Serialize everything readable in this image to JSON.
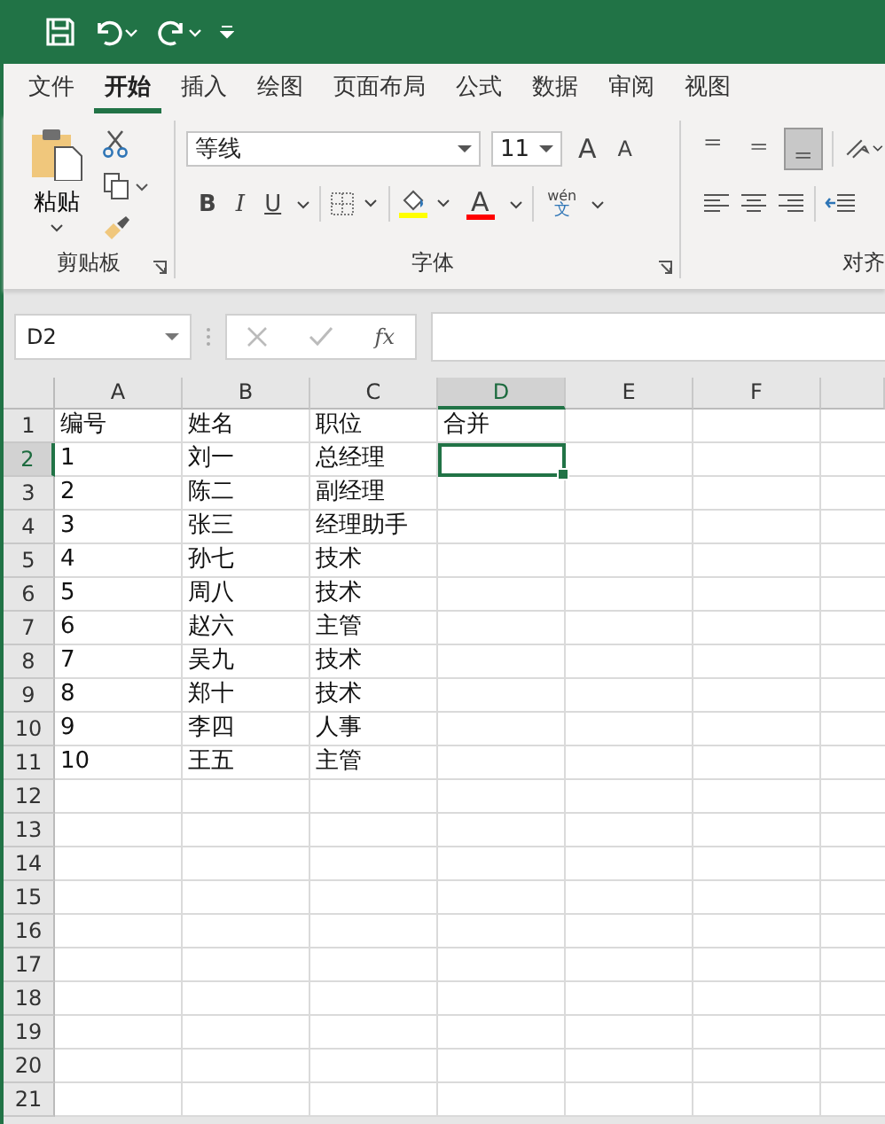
{
  "ribbon_tabs": [
    {
      "label": "文件",
      "selected": false
    },
    {
      "label": "开始",
      "selected": true
    },
    {
      "label": "插入",
      "selected": false
    },
    {
      "label": "绘图",
      "selected": false
    },
    {
      "label": "页面布局",
      "selected": false
    },
    {
      "label": "公式",
      "selected": false
    },
    {
      "label": "数据",
      "selected": false
    },
    {
      "label": "审阅",
      "selected": false
    },
    {
      "label": "视图",
      "selected": false
    }
  ],
  "clipboard_group": {
    "paste_label": "粘贴",
    "label": "剪贴板"
  },
  "font_group": {
    "font_name": "等线",
    "font_size": "11",
    "grow_font": "A",
    "shrink_font": "A",
    "bold": "B",
    "italic": "I",
    "underline": "U",
    "font_color": "A",
    "phonetic_top": "wén",
    "phonetic_bottom": "文",
    "label": "字体"
  },
  "alignment_group": {
    "vertical_align": [
      {
        "kind": "top",
        "selected": false
      },
      {
        "kind": "middle",
        "selected": false
      },
      {
        "kind": "bottom",
        "selected": true
      }
    ],
    "label": "对齐"
  },
  "formula_bar": {
    "name_box": "D2",
    "function_label": "fx"
  },
  "sheet": {
    "columns": [
      {
        "label": "A",
        "selected": false
      },
      {
        "label": "B",
        "selected": false
      },
      {
        "label": "C",
        "selected": false
      },
      {
        "label": "D",
        "selected": true
      },
      {
        "label": "E",
        "selected": false
      },
      {
        "label": "F",
        "selected": false
      }
    ],
    "rows": [
      {
        "number": "1",
        "selected": false,
        "cells": [
          "编号",
          "姓名",
          "职位",
          "合并"
        ]
      },
      {
        "number": "2",
        "selected": true,
        "cells": [
          "1",
          "刘一",
          "总经理"
        ]
      },
      {
        "number": "3",
        "selected": false,
        "cells": [
          "2",
          "陈二",
          "副经理"
        ]
      },
      {
        "number": "4",
        "selected": false,
        "cells": [
          "3",
          "张三",
          "经理助手"
        ]
      },
      {
        "number": "5",
        "selected": false,
        "cells": [
          "4",
          "孙七",
          "技术"
        ]
      },
      {
        "number": "6",
        "selected": false,
        "cells": [
          "5",
          "周八",
          "技术"
        ]
      },
      {
        "number": "7",
        "selected": false,
        "cells": [
          "6",
          "赵六",
          "主管"
        ]
      },
      {
        "number": "8",
        "selected": false,
        "cells": [
          "7",
          "吴九",
          "技术"
        ]
      },
      {
        "number": "9",
        "selected": false,
        "cells": [
          "8",
          "郑十",
          "技术"
        ]
      },
      {
        "number": "10",
        "selected": false,
        "cells": [
          "9",
          "李四",
          "人事"
        ]
      },
      {
        "number": "11",
        "selected": false,
        "cells": [
          "10",
          "王五",
          "主管"
        ]
      },
      {
        "number": "12",
        "selected": false
      },
      {
        "number": "13",
        "selected": false
      },
      {
        "number": "14",
        "selected": false
      },
      {
        "number": "15",
        "selected": false
      },
      {
        "number": "16",
        "selected": false
      },
      {
        "number": "17",
        "selected": false
      },
      {
        "number": "18",
        "selected": false
      },
      {
        "number": "19",
        "selected": false
      },
      {
        "number": "20",
        "selected": false
      },
      {
        "number": "21",
        "selected": false
      }
    ]
  }
}
